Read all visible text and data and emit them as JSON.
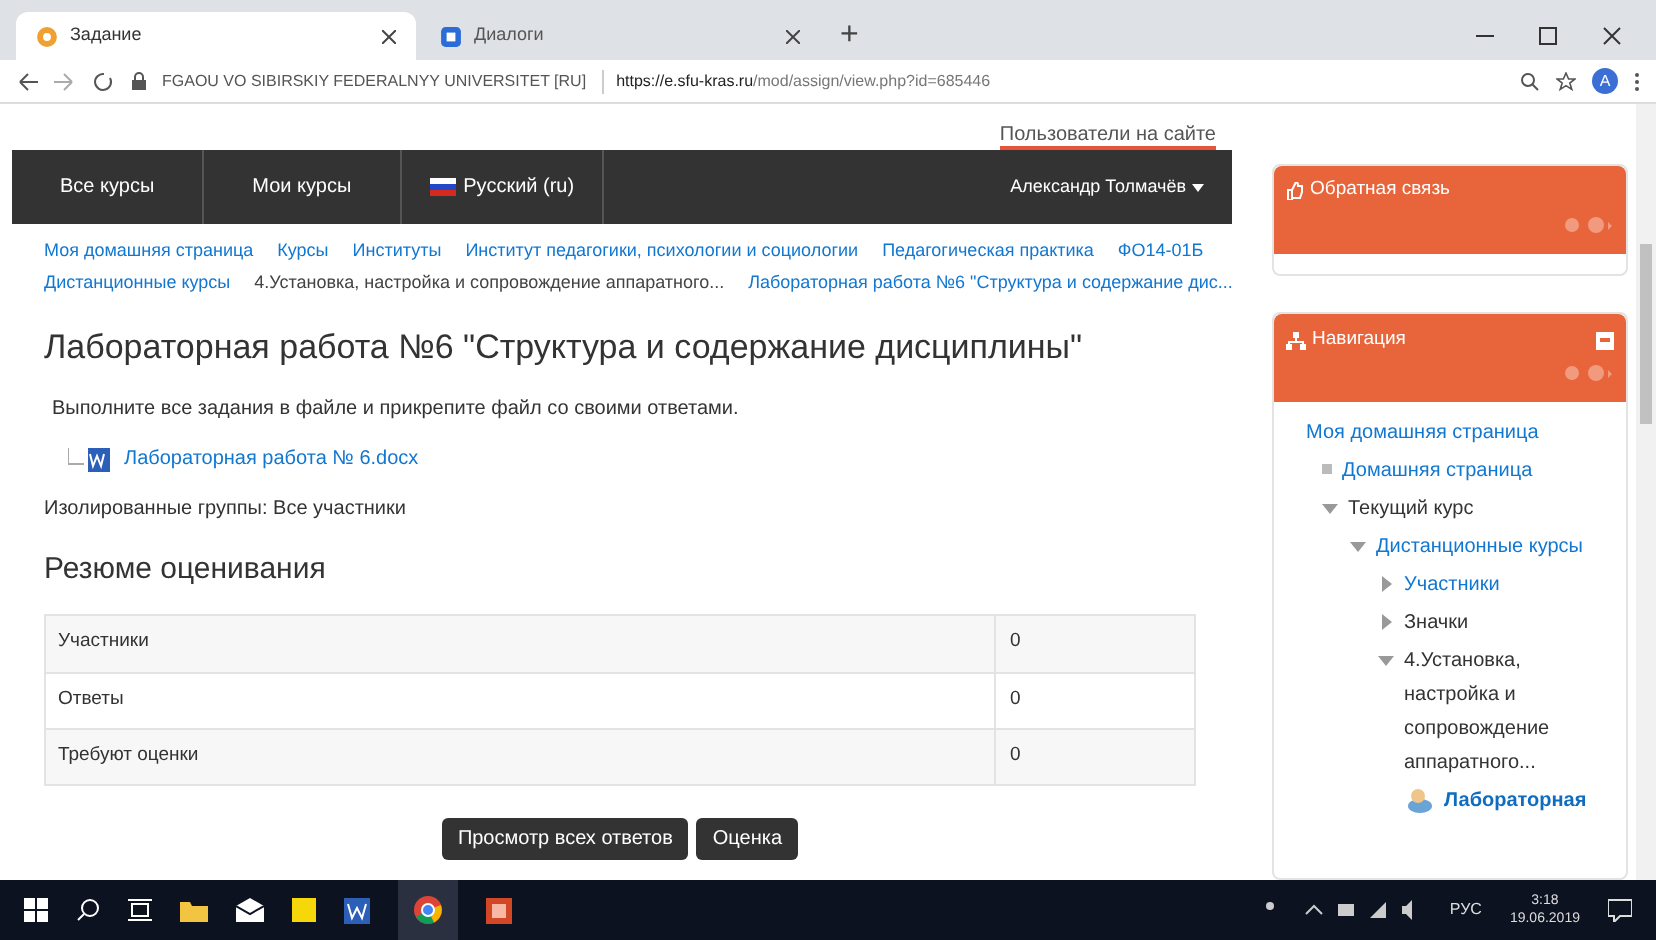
{
  "browser": {
    "tabs": [
      {
        "title": "Задание",
        "selected": true
      },
      {
        "title": "Диалоги",
        "selected": false
      }
    ],
    "new_tab": "+",
    "address": {
      "site": "FGAOU VO SIBIRSKIY FEDERALNYY UNIVERSITET [RU]",
      "host": "https://e.sfu-kras.ru",
      "path": "/mod/assign/view.php?id=685446"
    },
    "profile": "A"
  },
  "top_link": "Пользователи на сайте",
  "navbar": {
    "items": [
      "Все курсы",
      "Мои курсы"
    ],
    "language": "Русский (ru)",
    "user": "Александр Толмачёв"
  },
  "breadcrumb": [
    [
      {
        "label": "Моя домашняя страница",
        "kind": "link"
      },
      {
        "label": "Курсы",
        "kind": "link"
      },
      {
        "label": "Институты",
        "kind": "link"
      },
      {
        "label": "Институт педагогики, психологии и социологии",
        "kind": "link"
      },
      {
        "label": "Педагогическая практика",
        "kind": "link"
      },
      {
        "label": "ФО14-01Б",
        "kind": "link"
      }
    ],
    [
      {
        "label": "Дистанционные курсы",
        "kind": "link"
      },
      {
        "label": "4.Установка, настройка и сопровождение аппаратного...",
        "kind": "text"
      },
      {
        "label": "Лабораторная работа №6 \"Структура и содержание дис...",
        "kind": "link"
      }
    ]
  ],
  "main": {
    "title": "Лабораторная работа №6 \"Структура и содержание дисциплины\"",
    "intro": "Выполните все задания в файле и прикрепите файл со своими ответами.",
    "file": "Лабораторная работа № 6.docx",
    "groups": "Изолированные группы: Все участники",
    "summary_heading": "Резюме оценивания",
    "table": [
      {
        "label": "Участники",
        "value": "0"
      },
      {
        "label": "Ответы",
        "value": "0"
      },
      {
        "label": "Требуют оценки",
        "value": "0"
      }
    ],
    "buttons": [
      "Просмотр всех ответов",
      "Оценка"
    ]
  },
  "sidebar": {
    "feedback": {
      "title": "Обратная связь"
    },
    "navigation": {
      "title": "Навигация",
      "expanded": true,
      "tree": [
        {
          "label": "Моя домашняя страница",
          "kind": "root",
          "children": [
            {
              "label": "Домашняя страница",
              "kind": "leaf",
              "link": true
            },
            {
              "label": "Текущий курс",
              "kind": "branch",
              "expanded": true,
              "link": false,
              "children": [
                {
                  "label": "Дистанционные курсы",
                  "kind": "branch",
                  "expanded": true,
                  "link": true,
                  "children": [
                    {
                      "label": "Участники",
                      "kind": "branch",
                      "expanded": false,
                      "link": true
                    },
                    {
                      "label": "Значки",
                      "kind": "branch",
                      "expanded": false,
                      "link": false
                    },
                    {
                      "label": "4.Установка, настройка и сопровождение аппаратного...",
                      "kind": "branch",
                      "expanded": true,
                      "link": false,
                      "children": [
                        {
                          "label": "Лабораторная",
                          "kind": "activity"
                        }
                      ]
                    }
                  ]
                }
              ]
            }
          ]
        }
      ]
    }
  },
  "taskbar": {
    "language": "РУС",
    "time": "3:18",
    "date": "19.06.2019"
  }
}
